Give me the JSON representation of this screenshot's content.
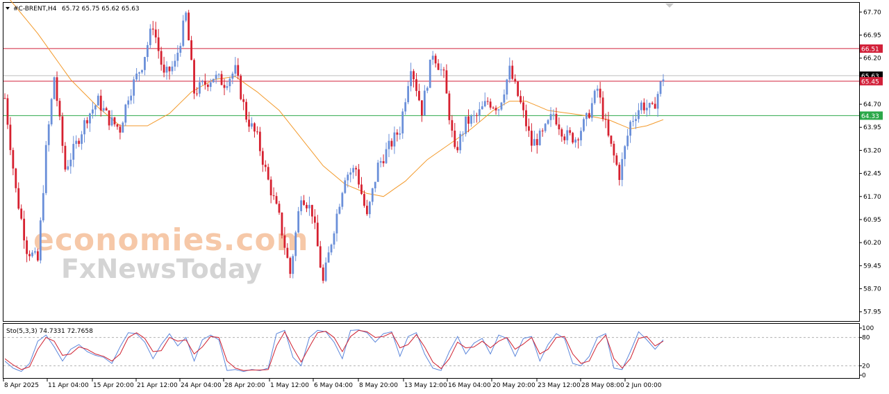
{
  "chart_data": {
    "type": "candlestick",
    "title": "#C-BRENT,H4",
    "ohlc_header": "65.72 65.75 65.62 65.63",
    "price_axis": {
      "ylim": [
        57.65,
        68.0
      ],
      "ticks": [
        "67.70",
        "66.95",
        "66.20",
        "65.45",
        "64.70",
        "63.95",
        "63.20",
        "62.45",
        "61.70",
        "60.95",
        "60.20",
        "59.45",
        "58.70",
        "57.95"
      ]
    },
    "time_axis": {
      "labels": [
        "8 Apr 2025",
        "11 Apr 04:00",
        "15 Apr 20:00",
        "21 Apr 12:00",
        "24 Apr 04:00",
        "28 Apr 20:00",
        "1 May 12:00",
        "6 May 04:00",
        "8 May 20:00",
        "13 May 12:00",
        "16 May 04:00",
        "20 May 20:00",
        "23 May 12:00",
        "28 May 08:00",
        "2 Jun 00:00"
      ]
    },
    "price_tags": [
      {
        "value": 66.51,
        "label": "66.51",
        "color": "#d2213a",
        "line": true
      },
      {
        "value": 65.63,
        "label": "65.63",
        "color": "#000000",
        "line": true
      },
      {
        "value": 65.45,
        "label": "65.45",
        "color": "#d2213a",
        "line": true
      },
      {
        "value": 64.33,
        "label": "64.33",
        "color": "#2ca84a",
        "line": true
      }
    ],
    "close_path": [
      [
        0,
        64.9
      ],
      [
        4,
        61.9
      ],
      [
        8,
        60.0
      ],
      [
        12,
        59.6
      ],
      [
        15,
        63.2
      ],
      [
        18,
        65.6
      ],
      [
        22,
        62.6
      ],
      [
        26,
        63.4
      ],
      [
        30,
        64.3
      ],
      [
        34,
        64.8
      ],
      [
        38,
        64.2
      ],
      [
        42,
        63.9
      ],
      [
        45,
        65.0
      ],
      [
        50,
        66.0
      ],
      [
        54,
        67.3
      ],
      [
        58,
        65.6
      ],
      [
        62,
        66.0
      ],
      [
        66,
        67.6
      ],
      [
        69,
        65.1
      ],
      [
        72,
        65.3
      ],
      [
        76,
        65.6
      ],
      [
        80,
        65.4
      ],
      [
        84,
        65.8
      ],
      [
        88,
        64.3
      ],
      [
        92,
        63.6
      ],
      [
        96,
        62.2
      ],
      [
        100,
        61.0
      ],
      [
        104,
        59.2
      ],
      [
        108,
        61.8
      ],
      [
        112,
        61.2
      ],
      [
        116,
        58.9
      ],
      [
        120,
        60.7
      ],
      [
        124,
        62.4
      ],
      [
        128,
        62.6
      ],
      [
        132,
        61.0
      ],
      [
        136,
        62.7
      ],
      [
        140,
        63.3
      ],
      [
        144,
        63.9
      ],
      [
        148,
        66.0
      ],
      [
        152,
        64.5
      ],
      [
        156,
        66.4
      ],
      [
        160,
        65.6
      ],
      [
        164,
        63.1
      ],
      [
        168,
        64.1
      ],
      [
        172,
        64.3
      ],
      [
        176,
        64.8
      ],
      [
        180,
        64.6
      ],
      [
        184,
        65.8
      ],
      [
        188,
        64.7
      ],
      [
        192,
        63.4
      ],
      [
        196,
        63.7
      ],
      [
        200,
        64.4
      ],
      [
        204,
        63.7
      ],
      [
        208,
        63.6
      ],
      [
        212,
        64.2
      ],
      [
        216,
        65.2
      ],
      [
        220,
        63.6
      ],
      [
        224,
        62.4
      ],
      [
        228,
        64.1
      ],
      [
        232,
        64.7
      ],
      [
        236,
        64.5
      ],
      [
        240,
        65.6
      ]
    ],
    "close_path_note_units": [
      "bar_index",
      "price"
    ],
    "ma_path": [
      [
        0,
        68.3
      ],
      [
        12,
        67.0
      ],
      [
        24,
        65.5
      ],
      [
        34,
        64.6
      ],
      [
        42,
        64.0
      ],
      [
        52,
        64.0
      ],
      [
        60,
        64.4
      ],
      [
        68,
        65.1
      ],
      [
        76,
        65.5
      ],
      [
        84,
        65.6
      ],
      [
        92,
        65.1
      ],
      [
        100,
        64.5
      ],
      [
        108,
        63.6
      ],
      [
        116,
        62.7
      ],
      [
        124,
        62.1
      ],
      [
        132,
        61.8
      ],
      [
        138,
        61.7
      ],
      [
        146,
        62.2
      ],
      [
        154,
        62.9
      ],
      [
        162,
        63.4
      ],
      [
        170,
        63.9
      ],
      [
        178,
        64.5
      ],
      [
        184,
        64.8
      ],
      [
        190,
        64.8
      ],
      [
        198,
        64.5
      ],
      [
        206,
        64.4
      ],
      [
        214,
        64.3
      ],
      [
        220,
        64.2
      ],
      [
        228,
        63.9
      ],
      [
        234,
        64.0
      ],
      [
        240,
        64.2
      ]
    ],
    "ma_color": "#f39a2b",
    "bull_color": "#6a8fd9",
    "bear_color": "#d6202f",
    "stochastic": {
      "label": "Sto(5,3,3) 74.7331 72.7658",
      "ylim": [
        0,
        100
      ],
      "ticks": [
        "100",
        "80",
        "20",
        "0"
      ],
      "levels": [
        80,
        20
      ],
      "main_color": "#5b86db",
      "signal_color": "#cf1f2e",
      "main_path": [
        [
          0,
          30
        ],
        [
          3,
          15
        ],
        [
          6,
          8
        ],
        [
          9,
          25
        ],
        [
          12,
          72
        ],
        [
          15,
          85
        ],
        [
          18,
          60
        ],
        [
          21,
          30
        ],
        [
          24,
          55
        ],
        [
          27,
          65
        ],
        [
          30,
          50
        ],
        [
          33,
          42
        ],
        [
          36,
          38
        ],
        [
          39,
          25
        ],
        [
          42,
          60
        ],
        [
          45,
          90
        ],
        [
          48,
          88
        ],
        [
          51,
          70
        ],
        [
          54,
          35
        ],
        [
          57,
          65
        ],
        [
          60,
          88
        ],
        [
          63,
          62
        ],
        [
          66,
          80
        ],
        [
          69,
          30
        ],
        [
          72,
          75
        ],
        [
          75,
          85
        ],
        [
          78,
          75
        ],
        [
          81,
          10
        ],
        [
          84,
          12
        ],
        [
          87,
          8
        ],
        [
          90,
          12
        ],
        [
          93,
          10
        ],
        [
          96,
          15
        ],
        [
          99,
          88
        ],
        [
          102,
          95
        ],
        [
          105,
          38
        ],
        [
          108,
          20
        ],
        [
          111,
          80
        ],
        [
          114,
          95
        ],
        [
          117,
          92
        ],
        [
          120,
          70
        ],
        [
          123,
          35
        ],
        [
          126,
          95
        ],
        [
          129,
          96
        ],
        [
          132,
          90
        ],
        [
          135,
          70
        ],
        [
          138,
          88
        ],
        [
          141,
          92
        ],
        [
          144,
          40
        ],
        [
          147,
          82
        ],
        [
          150,
          90
        ],
        [
          153,
          45
        ],
        [
          156,
          15
        ],
        [
          159,
          10
        ],
        [
          162,
          50
        ],
        [
          165,
          82
        ],
        [
          168,
          45
        ],
        [
          171,
          68
        ],
        [
          174,
          78
        ],
        [
          177,
          45
        ],
        [
          180,
          85
        ],
        [
          183,
          78
        ],
        [
          186,
          40
        ],
        [
          189,
          78
        ],
        [
          192,
          82
        ],
        [
          195,
          30
        ],
        [
          198,
          65
        ],
        [
          201,
          88
        ],
        [
          204,
          78
        ],
        [
          207,
          25
        ],
        [
          210,
          20
        ],
        [
          213,
          40
        ],
        [
          216,
          80
        ],
        [
          219,
          88
        ],
        [
          222,
          15
        ],
        [
          225,
          12
        ],
        [
          228,
          50
        ],
        [
          231,
          92
        ],
        [
          234,
          75
        ],
        [
          237,
          55
        ],
        [
          240,
          75
        ]
      ],
      "signal_path": [
        [
          0,
          35
        ],
        [
          3,
          22
        ],
        [
          6,
          12
        ],
        [
          9,
          18
        ],
        [
          12,
          55
        ],
        [
          15,
          80
        ],
        [
          18,
          72
        ],
        [
          21,
          42
        ],
        [
          24,
          45
        ],
        [
          27,
          60
        ],
        [
          30,
          55
        ],
        [
          33,
          45
        ],
        [
          36,
          40
        ],
        [
          39,
          30
        ],
        [
          42,
          45
        ],
        [
          45,
          80
        ],
        [
          48,
          90
        ],
        [
          51,
          78
        ],
        [
          54,
          50
        ],
        [
          57,
          52
        ],
        [
          60,
          80
        ],
        [
          63,
          72
        ],
        [
          66,
          75
        ],
        [
          69,
          45
        ],
        [
          72,
          60
        ],
        [
          75,
          82
        ],
        [
          78,
          80
        ],
        [
          81,
          30
        ],
        [
          84,
          15
        ],
        [
          87,
          10
        ],
        [
          90,
          11
        ],
        [
          93,
          11
        ],
        [
          96,
          12
        ],
        [
          99,
          62
        ],
        [
          102,
          92
        ],
        [
          105,
          58
        ],
        [
          108,
          28
        ],
        [
          111,
          60
        ],
        [
          114,
          90
        ],
        [
          117,
          93
        ],
        [
          120,
          80
        ],
        [
          123,
          50
        ],
        [
          126,
          82
        ],
        [
          129,
          95
        ],
        [
          132,
          92
        ],
        [
          135,
          80
        ],
        [
          138,
          82
        ],
        [
          141,
          90
        ],
        [
          144,
          58
        ],
        [
          147,
          65
        ],
        [
          150,
          86
        ],
        [
          153,
          60
        ],
        [
          156,
          28
        ],
        [
          159,
          14
        ],
        [
          162,
          35
        ],
        [
          165,
          70
        ],
        [
          168,
          58
        ],
        [
          171,
          60
        ],
        [
          174,
          72
        ],
        [
          177,
          58
        ],
        [
          180,
          72
        ],
        [
          183,
          80
        ],
        [
          186,
          55
        ],
        [
          189,
          66
        ],
        [
          192,
          80
        ],
        [
          195,
          45
        ],
        [
          198,
          55
        ],
        [
          201,
          80
        ],
        [
          204,
          82
        ],
        [
          207,
          45
        ],
        [
          210,
          25
        ],
        [
          213,
          30
        ],
        [
          216,
          65
        ],
        [
          219,
          85
        ],
        [
          222,
          35
        ],
        [
          225,
          15
        ],
        [
          228,
          35
        ],
        [
          231,
          78
        ],
        [
          234,
          82
        ],
        [
          237,
          62
        ],
        [
          240,
          72
        ]
      ]
    }
  },
  "watermark": {
    "line1": "economies.com",
    "line2": "FxNewsToday"
  }
}
